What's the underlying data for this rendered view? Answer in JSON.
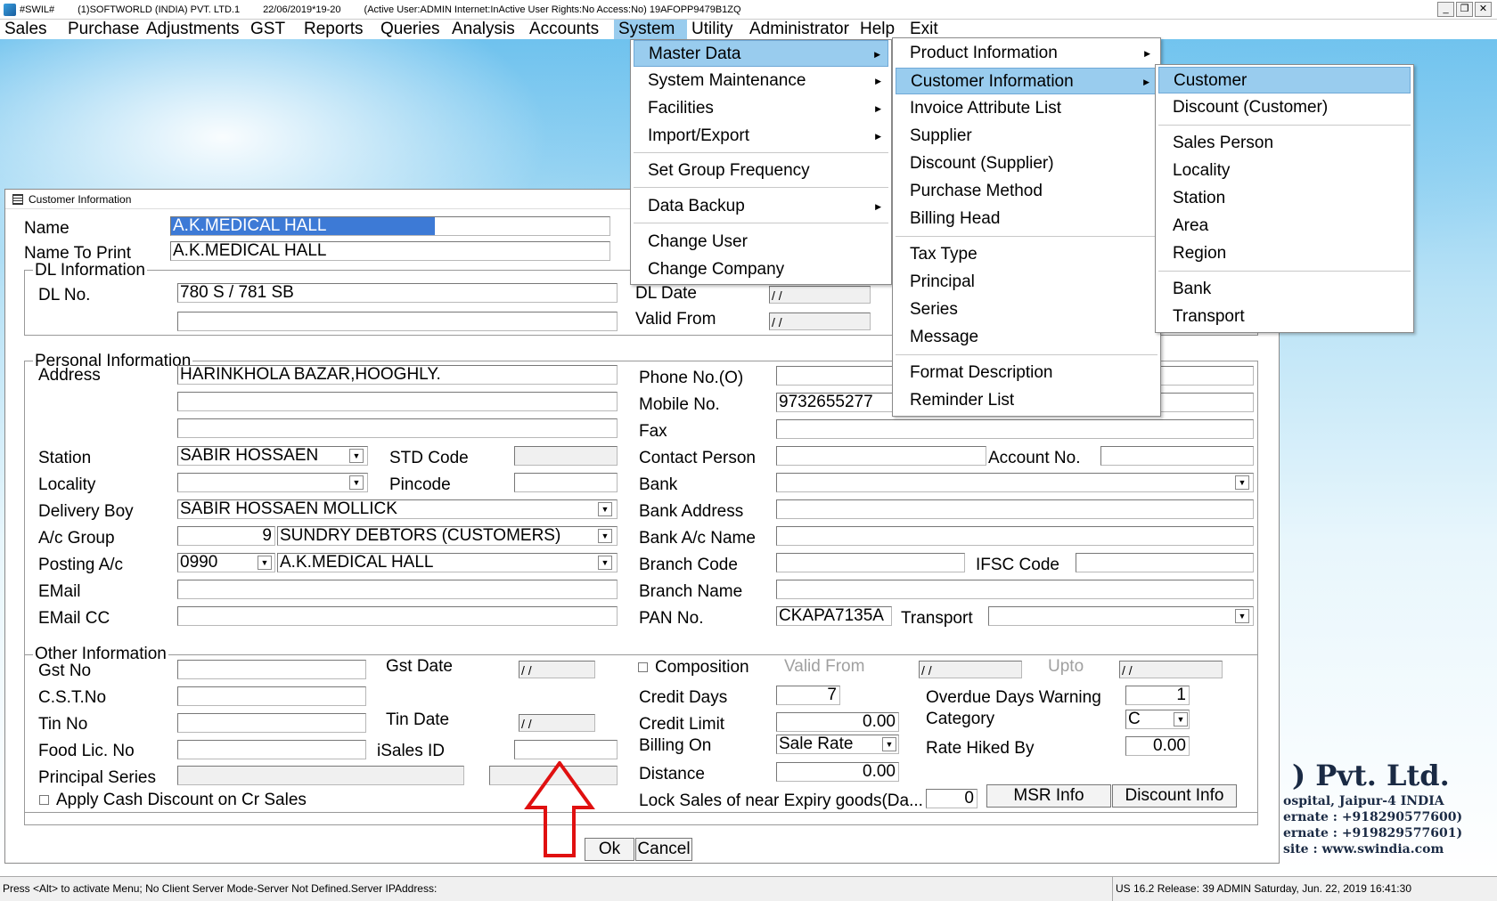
{
  "titlebar": {
    "app": "#SWIL#",
    "company": "(1)SOFTWORLD (INDIA) PVT. LTD.1",
    "date": "22/06/2019*19-20",
    "status": "(Active User:ADMIN Internet:InActive User Rights:No Access:No) 19AFOPP9479B1ZQ"
  },
  "menubar": [
    "Sales",
    "Purchase",
    "Adjustments",
    "GST",
    "Reports",
    "Queries",
    "Analysis",
    "Accounts",
    "System",
    "Utility",
    "Administrator",
    "Help",
    "Exit"
  ],
  "system_menu": {
    "items": [
      "Master Data",
      "System Maintenance",
      "Facilities",
      "Import/Export",
      "Set Group Frequency",
      "Data Backup",
      "Change User",
      "Change Company"
    ]
  },
  "master_data_menu": {
    "items": [
      "Product Information",
      "Customer Information",
      "Invoice Attribute List",
      "Supplier",
      "Discount (Supplier)",
      "Purchase Method",
      "Billing Head",
      "Tax Type",
      "Principal",
      "Series",
      "Message",
      "Format Description",
      "Reminder List"
    ]
  },
  "customer_info_menu": {
    "items": [
      "Customer",
      "Discount (Customer)",
      "Sales Person",
      "Locality",
      "Station",
      "Area",
      "Region",
      "Bank",
      "Transport"
    ]
  },
  "window": {
    "title": "Customer Information",
    "name_label": "Name",
    "name_value": "A.K.MEDICAL HALL",
    "name_to_print_label": "Name To Print",
    "name_to_print_value": "A.K.MEDICAL HALL",
    "dl_legend": "DL Information",
    "dl_no_label": "DL No.",
    "dl_no_value": "780 S / 781 SB",
    "dl_date_label": "DL  Date",
    "dl_date_value": "/ /",
    "valid_from_label": "Valid From",
    "valid_from_value": "/ /",
    "personal_legend": "Personal Information",
    "address_label": "Address",
    "address_value": "HARINKHOLA BAZAR,HOOGHLY.",
    "station_label": "Station",
    "station_value": "SABIR HOSSAEN",
    "std_code_label": "STD Code",
    "locality_label": "Locality",
    "pincode_label": "Pincode",
    "delivery_boy_label": "Delivery Boy",
    "delivery_boy_value": "SABIR HOSSAEN MOLLICK",
    "ac_group_label": "A/c Group",
    "ac_group_code": "9",
    "ac_group_value": "SUNDRY DEBTORS (CUSTOMERS)",
    "posting_ac_label": "Posting A/c",
    "posting_ac_code": "0990",
    "posting_ac_value": "A.K.MEDICAL HALL",
    "email_label": "EMail",
    "email_cc_label": "EMail CC",
    "phone_label": "Phone No.(O)",
    "mobile_label": "Mobile No.",
    "mobile_value": "9732655277",
    "fax_label": "Fax",
    "contact_person_label": "Contact Person",
    "account_no_label": "Account No.",
    "bank_label": "Bank",
    "bank_address_label": "Bank Address",
    "bank_ac_name_label": "Bank A/c Name",
    "branch_code_label": "Branch Code",
    "ifsc_label": "IFSC Code",
    "branch_name_label": "Branch Name",
    "pan_label": "PAN No.",
    "pan_value": "CKAPA7135A",
    "transport_label": "Transport",
    "other_legend": "Other Information",
    "gst_no_label": "Gst No",
    "gst_date_label": "Gst Date",
    "gst_date_value": "/ /",
    "cst_label": "C.S.T.No",
    "tin_label": "Tin No",
    "tin_date_label": "Tin Date",
    "tin_date_value": "/ /",
    "food_lic_label": "Food Lic. No",
    "isales_label": "iSales ID",
    "principal_series_label": "Principal Series",
    "apply_cash_label": "Apply Cash Discount on Cr Sales",
    "composition_label": "Composition",
    "comp_valid_from_label": "Valid From",
    "comp_valid_from_value": "/ /",
    "upto_label": "Upto",
    "upto_value": "/ /",
    "credit_days_label": "Credit Days",
    "credit_days_value": "7",
    "credit_limit_label": "Credit Limit",
    "credit_limit_value": "0.00",
    "billing_on_label": "Billing On",
    "billing_on_value": "Sale Rate",
    "distance_label": "Distance",
    "distance_value": "0.00",
    "lock_sales_label": "Lock Sales of near Expiry goods(Da...",
    "lock_sales_value": "0",
    "overdue_label": "Overdue Days Warning",
    "overdue_value": "1",
    "category_label": "Category",
    "category_value": "C",
    "rate_hiked_label": "Rate Hiked By",
    "rate_hiked_value": "0.00",
    "msr_button": "MSR Info",
    "discount_button": "Discount Info",
    "ok_button": "Ok",
    "cancel_button": "Cancel"
  },
  "background_brand": {
    "title": ") Pvt. Ltd.",
    "line1": "ospital, Jaipur-4 INDIA",
    "line2": "ernate : +918290577600)",
    "line3": "ernate : +919829577601)",
    "line4": "site : www.swindia.com"
  },
  "statusbar": {
    "left": "Press <Alt> to activate Menu; No Client Server Mode-Server Not Defined.Server IPAddress:",
    "right": "US 16.2 Release: 39 ADMIN  Saturday, Jun. 22, 2019  16:41:30"
  },
  "colors": {
    "menu_highlight": "#99ccee",
    "selection": "#3d7ad6",
    "arrow": "#e01010"
  }
}
